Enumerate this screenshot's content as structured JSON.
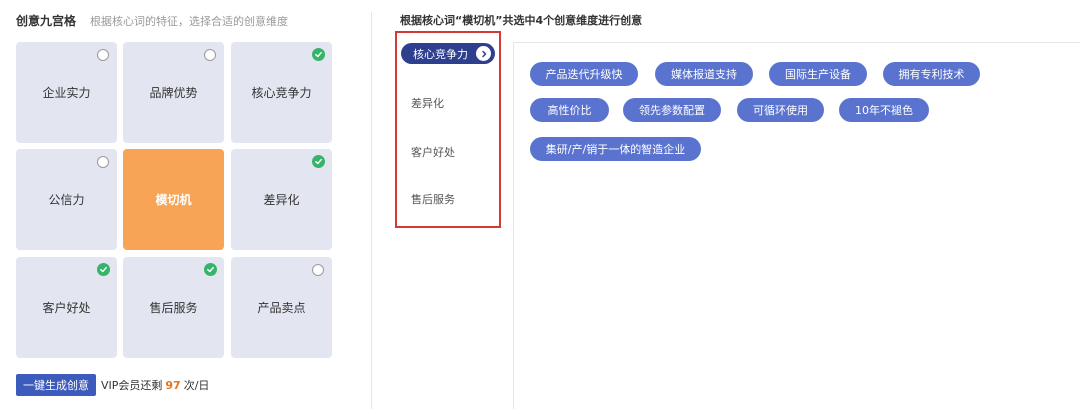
{
  "left": {
    "title": "创意九宫格",
    "subtitle": "根据核心词的特征，选择合适的创意维度"
  },
  "grid": [
    {
      "label": "企业实力",
      "state": "unchecked"
    },
    {
      "label": "品牌优势",
      "state": "unchecked"
    },
    {
      "label": "核心竞争力",
      "state": "checked"
    },
    {
      "label": "公信力",
      "state": "unchecked"
    },
    {
      "label": "模切机",
      "state": "center"
    },
    {
      "label": "差异化",
      "state": "checked"
    },
    {
      "label": "客户好处",
      "state": "checked"
    },
    {
      "label": "售后服务",
      "state": "checked"
    },
    {
      "label": "产品卖点",
      "state": "unchecked"
    }
  ],
  "footer": {
    "generate_label": "一键生成创意",
    "vip_prefix": "VIP会员还剩",
    "vip_count": "97",
    "vip_suffix": "次/日"
  },
  "right": {
    "header": "根据核心词“模切机”共选中4个创意维度进行创意",
    "dimensions": [
      "核心竞争力",
      "差异化",
      "客户好处",
      "售后服务"
    ],
    "active_dimension": "核心竞争力",
    "keywords": [
      "产品迭代升级快",
      "媒体报道支持",
      "国际生产设备",
      "拥有专利技术",
      "高性价比",
      "领先参数配置",
      "可循环使用",
      "10年不褪色",
      "集研/产/销于一体的智造企业"
    ]
  },
  "colors": {
    "cell_bg": "#e3e6f0",
    "center_bg": "#f7a456",
    "check_green": "#35b46a",
    "primary_blue": "#3d5bbd",
    "active_tab": "#2e3f8f",
    "keyword_chip": "#5a73cf",
    "highlight_border": "#d33a35",
    "vip_orange": "#e8741c"
  }
}
